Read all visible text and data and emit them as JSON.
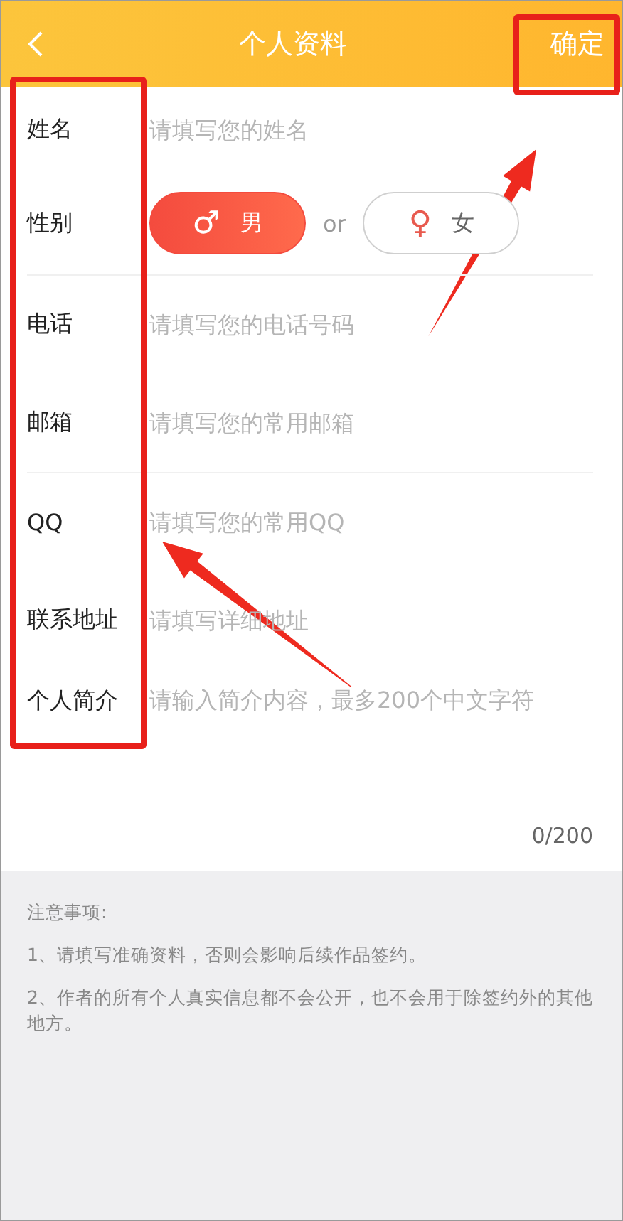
{
  "header": {
    "title": "个人资料",
    "confirm": "确定"
  },
  "fields": [
    {
      "kind": "text",
      "label": "姓名",
      "placeholder": "请填写您的姓名",
      "divider": false
    },
    {
      "kind": "gender",
      "label": "性别",
      "separator": "or",
      "options": [
        {
          "label": "男",
          "symbol": "♂",
          "selected": true
        },
        {
          "label": "女",
          "symbol": "♀",
          "selected": false
        }
      ],
      "divider": true
    },
    {
      "kind": "text",
      "label": "电话",
      "placeholder": "请填写您的电话号码",
      "divider": false
    },
    {
      "kind": "text",
      "label": "邮箱",
      "placeholder": "请填写您的常用邮箱",
      "divider": true
    },
    {
      "kind": "text",
      "label": "QQ",
      "placeholder": "请填写您的常用QQ",
      "divider": false
    },
    {
      "kind": "text",
      "label": "联系地址",
      "placeholder": "请填写详细地址",
      "divider": false
    },
    {
      "kind": "textarea",
      "label": "个人简介",
      "placeholder": "请输入简介内容，最多200个中文字符",
      "counter": "0/200",
      "divider": false
    }
  ],
  "notes": {
    "title": "注意事项:",
    "items": [
      "1、请填写准确资料，否则会影响后续作品签约。",
      "2、作者的所有个人真实信息都不会公开，也不会用于除签约外的其他地方。"
    ]
  }
}
